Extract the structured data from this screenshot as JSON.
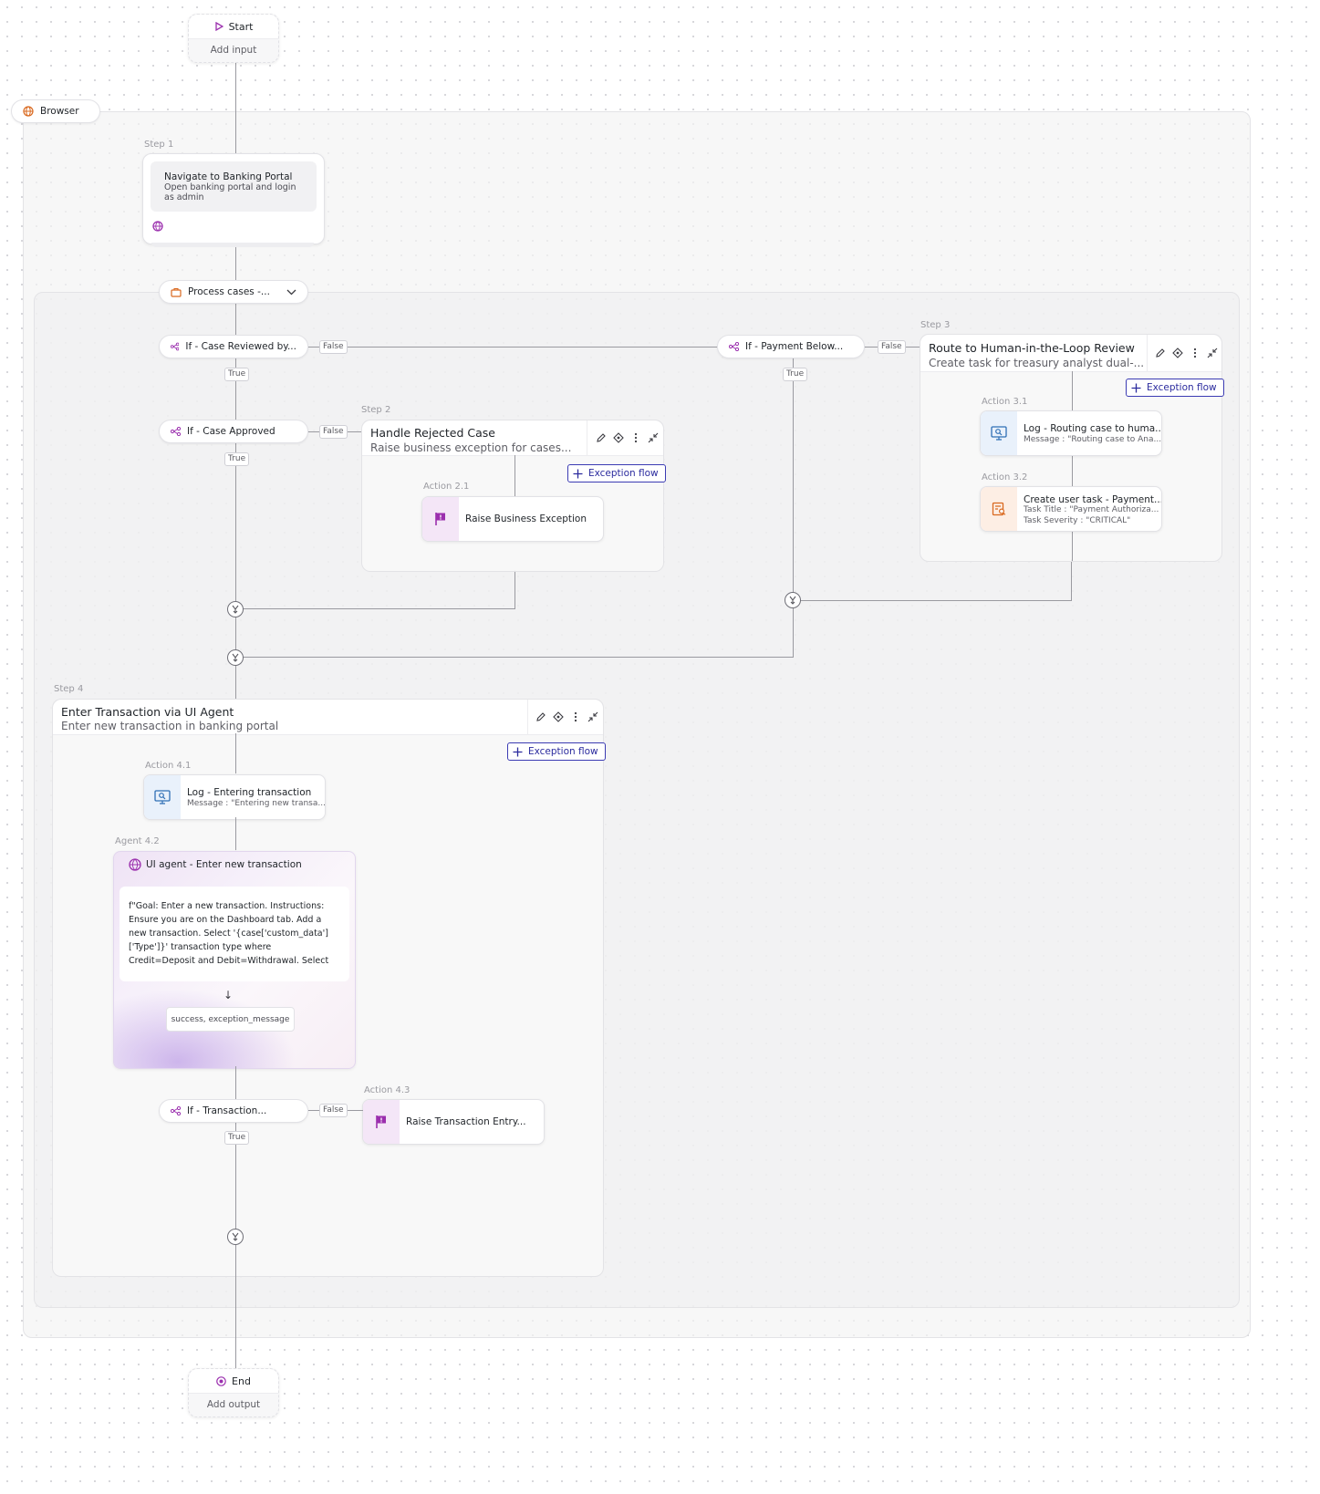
{
  "start": {
    "label": "Start",
    "sub": "Add input"
  },
  "end": {
    "label": "End",
    "sub": "Add output"
  },
  "browser": {
    "label": "Browser"
  },
  "step1": {
    "label": "Step 1",
    "title": "Navigate to Banking Portal",
    "desc": "Open banking portal and login as admin"
  },
  "loop": {
    "label": "Process cases -..."
  },
  "cond1": {
    "label": "If - Case Reviewed by...",
    "false": "False",
    "true": "True"
  },
  "cond2": {
    "label": "If - Case Approved",
    "false": "False",
    "true": "True"
  },
  "cond3": {
    "label": "If - Payment Below...",
    "false": "False",
    "true": "True"
  },
  "cond4": {
    "label": "If - Transaction...",
    "false": "False",
    "true": "True"
  },
  "step2": {
    "label": "Step 2",
    "title": "Handle Rejected Case",
    "sub": "Raise business exception for cases...",
    "exception": "Exception flow",
    "action_label": "Action 2.1",
    "action_title": "Raise Business Exception"
  },
  "step3": {
    "label": "Step 3",
    "title": "Route to Human-in-the-Loop Review",
    "sub": "Create task for treasury analyst dual-...",
    "exception": "Exception flow",
    "a1_label": "Action 3.1",
    "a1_title": "Log - Routing case to huma...",
    "a1_line": "Message : \"Routing case to Ana...",
    "a2_label": "Action 3.2",
    "a2_title": "Create user task - Payment...",
    "a2_line1": "Task Title : \"Payment Authoriza...",
    "a2_line2": "Task Severity : \"CRITICAL\""
  },
  "step4": {
    "label": "Step 4",
    "title": "Enter Transaction via UI Agent",
    "sub": "Enter new transaction in banking portal",
    "exception": "Exception flow",
    "a1_label": "Action 4.1",
    "a1_title": "Log - Entering transaction",
    "a1_line": "Message : \"Entering new transa...",
    "agent_label": "Agent 4.2",
    "agent_title": "UI agent - Enter new transaction",
    "agent_prompt": "f\"Goal: Enter a new transaction. Instructions: Ensure you are on the Dashboard tab. Add a new transaction. Select '{case['custom_data']['Type']}' transaction type where Credit=Deposit and Debit=Withdrawal. Select the checking account....",
    "agent_output": "success, exception_message",
    "a3_label": "Action 4.3",
    "a3_title": "Raise Transaction Entry..."
  },
  "colors": {
    "accent": "#3b3bb3",
    "purple": "#9b2fae",
    "orange": "#d9681e",
    "blue": "#2f6fb5"
  },
  "icons": [
    "play-icon",
    "globe-icon",
    "briefcase-icon",
    "branch-icon",
    "flag-icon",
    "log-icon",
    "user-task-icon",
    "agent-icon",
    "merge-icon",
    "plus-icon",
    "edit-icon",
    "diamond-icon",
    "more-icon",
    "collapse-icon",
    "chevron-down-icon",
    "stop-icon"
  ]
}
